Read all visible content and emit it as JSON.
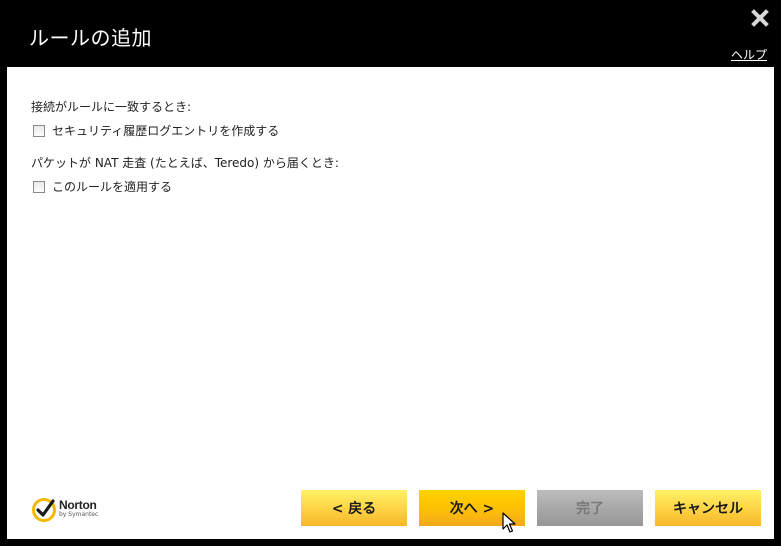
{
  "window": {
    "title": "ルールの追加",
    "help_label": "ヘルプ"
  },
  "content": {
    "section1_label": "接続がルールに一致するとき:",
    "option1_label": "セキュリティ履歴ログエントリを作成する",
    "option1_checked": false,
    "section2_label": "パケットが NAT 走査 (たとえば、Teredo) から届くとき:",
    "option2_label": "このルールを適用する",
    "option2_checked": false
  },
  "logo": {
    "name": "Norton",
    "sub": "by Symantec"
  },
  "buttons": {
    "back": "< 戻る",
    "next": "次へ >",
    "finish": "完了",
    "cancel": "キャンセル"
  },
  "colors": {
    "accent_yellow": "#ffd200",
    "title_bar": "#000000",
    "disabled_gray": "#a8a8a8"
  }
}
